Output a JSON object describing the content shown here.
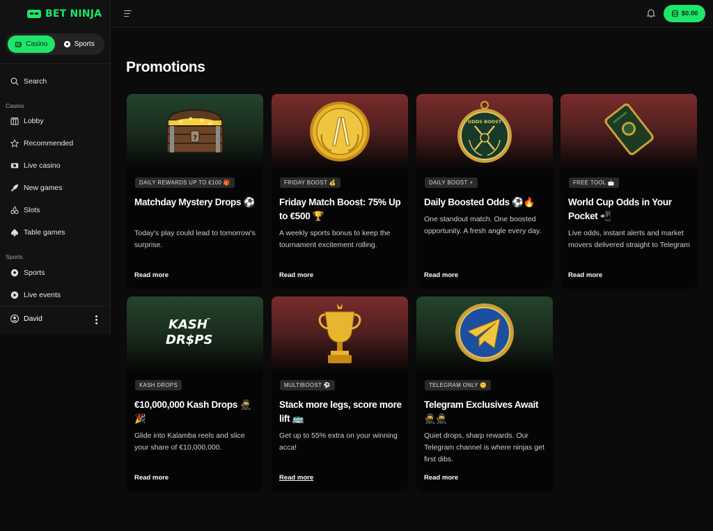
{
  "brand": {
    "name": "BET NINJA",
    "color": "#1fe56a"
  },
  "switcher": {
    "casino": "Casino",
    "sports": "Sports"
  },
  "sidebar": {
    "search": "Search",
    "casino_heading": "Casino",
    "casino_items": [
      {
        "label": "Lobby",
        "icon": "lobby-icon"
      },
      {
        "label": "Recommended",
        "icon": "star-icon"
      },
      {
        "label": "Live casino",
        "icon": "live-casino-icon"
      },
      {
        "label": "New games",
        "icon": "rocket-icon"
      },
      {
        "label": "Slots",
        "icon": "cherries-icon"
      },
      {
        "label": "Table games",
        "icon": "spade-icon"
      }
    ],
    "sports_heading": "Sports",
    "sports_items": [
      {
        "label": "Sports",
        "icon": "soccer-ball-icon"
      },
      {
        "label": "Live events",
        "icon": "play-circle-icon"
      }
    ],
    "user": "David"
  },
  "header": {
    "balance": "$0.00"
  },
  "page": {
    "title": "Promotions"
  },
  "promos": [
    {
      "tag": "DAILY REWARDS UP TO €100 🎁",
      "title": "Matchday Mystery Drops ⚽",
      "desc": "Today's play could lead to tomorrow's surprise.",
      "cta": "Read more",
      "theme": "green",
      "art": "treasure-chest"
    },
    {
      "tag": "FRIDAY BOOST 💰",
      "title": "Friday Match Boost: 75% Up to €500 🏆",
      "desc": "A weekly sports bonus to keep the tournament excitement rolling.",
      "cta": "Read more",
      "theme": "red",
      "art": "gold-coin"
    },
    {
      "tag": "DAILY BOOST ⚡",
      "title": "Daily Boosted Odds ⚽🔥",
      "desc": "One standout match. One boosted opportunity. A fresh angle every day.",
      "cta": "Read more",
      "theme": "red",
      "art": "odds-boost-medal"
    },
    {
      "tag": "FREE TOOL 📩",
      "title": "World Cup Odds in Your Pocket 📲",
      "desc": "Live odds, instant alerts and market movers delivered straight to Telegram",
      "cta": "Read more",
      "theme": "red",
      "art": "phone"
    },
    {
      "tag": "KASH DROPS",
      "title": "€10,000,000 Kash Drops 🥷🎉",
      "desc": "Glide into Kalamba reels and slice your share of €10,000,000.",
      "cta": "Read more",
      "theme": "green",
      "art": "kash-drops-logo"
    },
    {
      "tag": "MULTIBOOST ⚽",
      "title": "Stack more legs, score more lift 🚌",
      "desc": "Get up to 55% extra on your winning acca!",
      "cta": "Read more",
      "theme": "red",
      "art": "trophy"
    },
    {
      "tag": "TELEGRAM ONLY 🤫",
      "title": "Telegram Exclusives Await 🥷🥷",
      "desc": "Quiet drops, sharp rewards. Our Telegram channel is where ninjas get first dibs.",
      "cta": "Read more",
      "theme": "green",
      "art": "telegram-coin"
    }
  ],
  "art_text": {
    "odds_boost": "ODDS BOOST",
    "kash_line1": "KASH",
    "kash_line2": "DR$PS",
    "kash_tm": "™"
  }
}
